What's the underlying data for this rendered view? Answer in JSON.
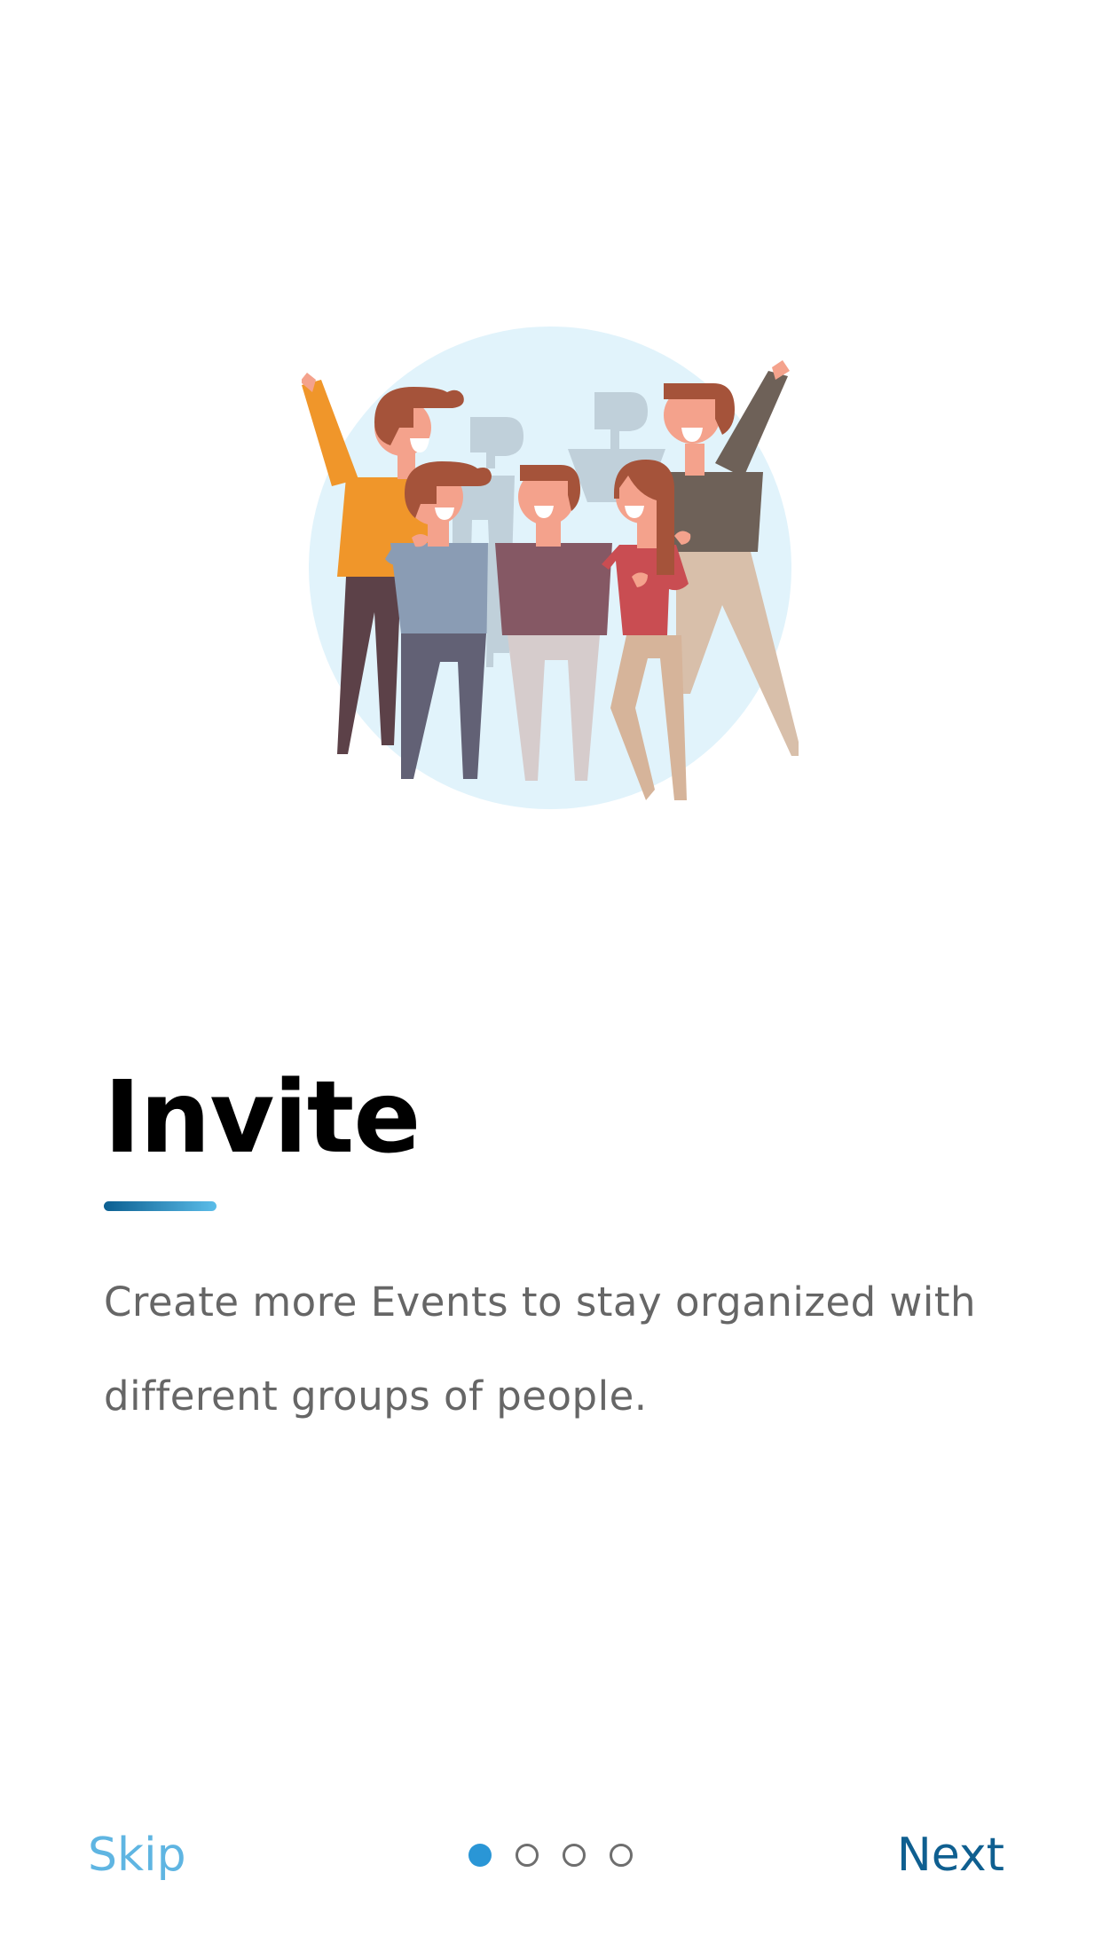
{
  "onboarding": {
    "illustration_name": "group-of-friends-illustration",
    "title": "Invite",
    "description": "Create more Events to stay organized with different groups of people.",
    "skip_label": "Skip",
    "next_label": "Next",
    "pagination": {
      "total_pages": 4,
      "current_page": 1
    }
  },
  "colors": {
    "accent_light": "#5fb5e2",
    "accent_dark": "#0f5f90",
    "active_dot": "#2a96d6",
    "illustration_background": "#e3f3fb"
  }
}
